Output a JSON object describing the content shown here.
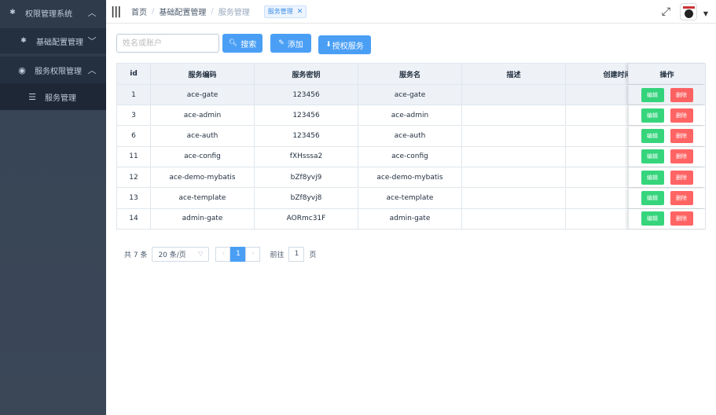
{
  "sidebar": {
    "title": "权限管理系统",
    "items": [
      {
        "label": "基础配置管理"
      },
      {
        "label": "服务权限管理"
      },
      {
        "label": "服务管理"
      }
    ]
  },
  "header": {
    "breadcrumb": [
      "首页",
      "基础配置管理",
      "服务管理"
    ],
    "tag": "服务管理"
  },
  "toolbar": {
    "search_placeholder": "姓名或账户",
    "search_label": "搜索",
    "add_label": "添加",
    "auth_label": "授权服务"
  },
  "table": {
    "columns": [
      "id",
      "服务编码",
      "服务密钥",
      "服务名",
      "描述",
      "创建时间",
      "操作"
    ],
    "edit_label": "编辑",
    "delete_label": "删除",
    "rows": [
      {
        "id": "1",
        "code": "ace-gate",
        "secret": "123456",
        "name": "ace-gate",
        "desc": "",
        "created": ""
      },
      {
        "id": "3",
        "code": "ace-admin",
        "secret": "123456",
        "name": "ace-admin",
        "desc": "",
        "created": ""
      },
      {
        "id": "6",
        "code": "ace-auth",
        "secret": "123456",
        "name": "ace-auth",
        "desc": "",
        "created": ""
      },
      {
        "id": "11",
        "code": "ace-config",
        "secret": "fXHsssa2",
        "name": "ace-config",
        "desc": "",
        "created": ""
      },
      {
        "id": "12",
        "code": "ace-demo-mybatis",
        "secret": "bZf8yvj9",
        "name": "ace-demo-mybatis",
        "desc": "",
        "created": ""
      },
      {
        "id": "13",
        "code": "ace-template",
        "secret": "bZf8yvj8",
        "name": "ace-template",
        "desc": "",
        "created": ""
      },
      {
        "id": "14",
        "code": "admin-gate",
        "secret": "AORmc31F",
        "name": "admin-gate",
        "desc": "",
        "created": ""
      }
    ]
  },
  "pagination": {
    "total": "共 7 条",
    "page_size": "20 条/页",
    "current": "1",
    "goto_prefix": "前往",
    "goto_value": "1",
    "goto_suffix": "页"
  },
  "colors": {
    "sidebar_bg": "#2f3a4a",
    "primary": "#4a9ff5",
    "success": "#13ce66",
    "danger": "#ff4949"
  }
}
